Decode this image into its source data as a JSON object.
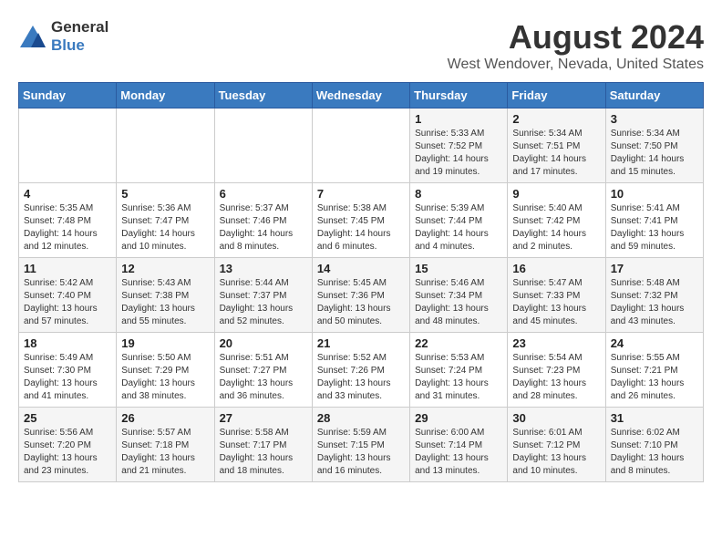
{
  "header": {
    "logo_general": "General",
    "logo_blue": "Blue",
    "month": "August 2024",
    "location": "West Wendover, Nevada, United States"
  },
  "calendar": {
    "days_of_week": [
      "Sunday",
      "Monday",
      "Tuesday",
      "Wednesday",
      "Thursday",
      "Friday",
      "Saturday"
    ],
    "weeks": [
      [
        {
          "day": "",
          "info": ""
        },
        {
          "day": "",
          "info": ""
        },
        {
          "day": "",
          "info": ""
        },
        {
          "day": "",
          "info": ""
        },
        {
          "day": "1",
          "info": "Sunrise: 5:33 AM\nSunset: 7:52 PM\nDaylight: 14 hours\nand 19 minutes."
        },
        {
          "day": "2",
          "info": "Sunrise: 5:34 AM\nSunset: 7:51 PM\nDaylight: 14 hours\nand 17 minutes."
        },
        {
          "day": "3",
          "info": "Sunrise: 5:34 AM\nSunset: 7:50 PM\nDaylight: 14 hours\nand 15 minutes."
        }
      ],
      [
        {
          "day": "4",
          "info": "Sunrise: 5:35 AM\nSunset: 7:48 PM\nDaylight: 14 hours\nand 12 minutes."
        },
        {
          "day": "5",
          "info": "Sunrise: 5:36 AM\nSunset: 7:47 PM\nDaylight: 14 hours\nand 10 minutes."
        },
        {
          "day": "6",
          "info": "Sunrise: 5:37 AM\nSunset: 7:46 PM\nDaylight: 14 hours\nand 8 minutes."
        },
        {
          "day": "7",
          "info": "Sunrise: 5:38 AM\nSunset: 7:45 PM\nDaylight: 14 hours\nand 6 minutes."
        },
        {
          "day": "8",
          "info": "Sunrise: 5:39 AM\nSunset: 7:44 PM\nDaylight: 14 hours\nand 4 minutes."
        },
        {
          "day": "9",
          "info": "Sunrise: 5:40 AM\nSunset: 7:42 PM\nDaylight: 14 hours\nand 2 minutes."
        },
        {
          "day": "10",
          "info": "Sunrise: 5:41 AM\nSunset: 7:41 PM\nDaylight: 13 hours\nand 59 minutes."
        }
      ],
      [
        {
          "day": "11",
          "info": "Sunrise: 5:42 AM\nSunset: 7:40 PM\nDaylight: 13 hours\nand 57 minutes."
        },
        {
          "day": "12",
          "info": "Sunrise: 5:43 AM\nSunset: 7:38 PM\nDaylight: 13 hours\nand 55 minutes."
        },
        {
          "day": "13",
          "info": "Sunrise: 5:44 AM\nSunset: 7:37 PM\nDaylight: 13 hours\nand 52 minutes."
        },
        {
          "day": "14",
          "info": "Sunrise: 5:45 AM\nSunset: 7:36 PM\nDaylight: 13 hours\nand 50 minutes."
        },
        {
          "day": "15",
          "info": "Sunrise: 5:46 AM\nSunset: 7:34 PM\nDaylight: 13 hours\nand 48 minutes."
        },
        {
          "day": "16",
          "info": "Sunrise: 5:47 AM\nSunset: 7:33 PM\nDaylight: 13 hours\nand 45 minutes."
        },
        {
          "day": "17",
          "info": "Sunrise: 5:48 AM\nSunset: 7:32 PM\nDaylight: 13 hours\nand 43 minutes."
        }
      ],
      [
        {
          "day": "18",
          "info": "Sunrise: 5:49 AM\nSunset: 7:30 PM\nDaylight: 13 hours\nand 41 minutes."
        },
        {
          "day": "19",
          "info": "Sunrise: 5:50 AM\nSunset: 7:29 PM\nDaylight: 13 hours\nand 38 minutes."
        },
        {
          "day": "20",
          "info": "Sunrise: 5:51 AM\nSunset: 7:27 PM\nDaylight: 13 hours\nand 36 minutes."
        },
        {
          "day": "21",
          "info": "Sunrise: 5:52 AM\nSunset: 7:26 PM\nDaylight: 13 hours\nand 33 minutes."
        },
        {
          "day": "22",
          "info": "Sunrise: 5:53 AM\nSunset: 7:24 PM\nDaylight: 13 hours\nand 31 minutes."
        },
        {
          "day": "23",
          "info": "Sunrise: 5:54 AM\nSunset: 7:23 PM\nDaylight: 13 hours\nand 28 minutes."
        },
        {
          "day": "24",
          "info": "Sunrise: 5:55 AM\nSunset: 7:21 PM\nDaylight: 13 hours\nand 26 minutes."
        }
      ],
      [
        {
          "day": "25",
          "info": "Sunrise: 5:56 AM\nSunset: 7:20 PM\nDaylight: 13 hours\nand 23 minutes."
        },
        {
          "day": "26",
          "info": "Sunrise: 5:57 AM\nSunset: 7:18 PM\nDaylight: 13 hours\nand 21 minutes."
        },
        {
          "day": "27",
          "info": "Sunrise: 5:58 AM\nSunset: 7:17 PM\nDaylight: 13 hours\nand 18 minutes."
        },
        {
          "day": "28",
          "info": "Sunrise: 5:59 AM\nSunset: 7:15 PM\nDaylight: 13 hours\nand 16 minutes."
        },
        {
          "day": "29",
          "info": "Sunrise: 6:00 AM\nSunset: 7:14 PM\nDaylight: 13 hours\nand 13 minutes."
        },
        {
          "day": "30",
          "info": "Sunrise: 6:01 AM\nSunset: 7:12 PM\nDaylight: 13 hours\nand 10 minutes."
        },
        {
          "day": "31",
          "info": "Sunrise: 6:02 AM\nSunset: 7:10 PM\nDaylight: 13 hours\nand 8 minutes."
        }
      ]
    ]
  }
}
